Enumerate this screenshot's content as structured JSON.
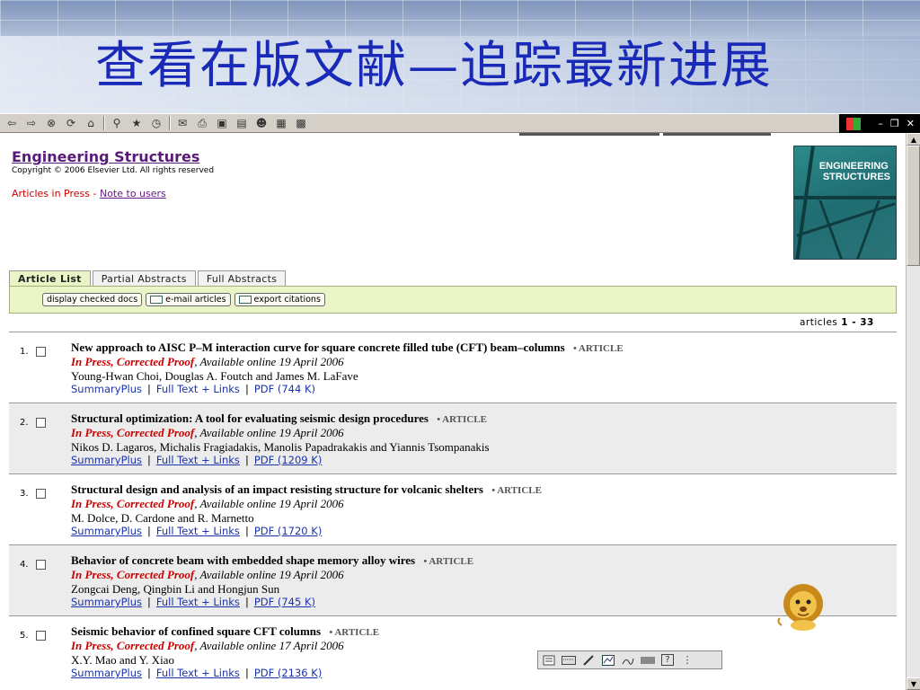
{
  "banner": {
    "title": "查看在版文献—追踪最新进展"
  },
  "toolbar": {
    "icons": [
      "back-icon",
      "forward-icon",
      "stop-icon",
      "refresh-icon",
      "home-icon",
      "search-icon",
      "favorites-icon",
      "history-icon",
      "mail-icon",
      "print-icon",
      "edit-icon",
      "discuss-icon",
      "messenger-icon",
      "research-icon",
      "media-icon"
    ],
    "glyphs": {
      "back": "⇦",
      "forward": "⇨",
      "stop": "⊗",
      "refresh": "⟳",
      "home": "⌂",
      "search": "⚲",
      "favorites": "★",
      "history": "◷",
      "mail": "✉",
      "print": "⎙",
      "edit": "▣",
      "discuss": "▤",
      "messenger": "☻",
      "research": "▦",
      "media": "▩"
    },
    "window_controls": {
      "minimize": "–",
      "restore": "❐",
      "close": "✕"
    }
  },
  "page": {
    "journal_title": "Engineering Structures",
    "copyright": "Copyright © 2006 Elsevier Ltd. All rights reserved",
    "articles_in_press": "Articles in Press",
    "separator": " - ",
    "note_to_users": "Note to users",
    "cover_text_line1": "ENGINEERING",
    "cover_text_line2": "STRUCTURES"
  },
  "tabs": [
    {
      "label": "Article List",
      "active": true
    },
    {
      "label": "Partial Abstracts",
      "active": false
    },
    {
      "label": "Full Abstracts",
      "active": false
    }
  ],
  "actions": {
    "display_checked": "display checked docs",
    "email_articles": "e-mail articles",
    "export_citations": "export citations"
  },
  "article_count": {
    "prefix": "articles ",
    "range": "1 - 33"
  },
  "articles": [
    {
      "num": "1.",
      "title": "New approach to AISC P–M interaction curve for square concrete filled tube (CFT) beam–columns",
      "type": "• ARTICLE",
      "in_press": "In Press, Corrected Proof",
      "available": ", Available online 19 April 2006",
      "authors": "Young-Hwan Choi, Douglas A. Foutch and James M. LaFave",
      "summary": "SummaryPlus",
      "fulltext": "Full Text + Links",
      "pdf": "PDF (744 K)"
    },
    {
      "num": "2.",
      "title": "Structural optimization: A tool for evaluating seismic design procedures",
      "type": "• ARTICLE",
      "in_press": "In Press, Corrected Proof",
      "available": ", Available online 19 April 2006",
      "authors": "Nikos D. Lagaros, Michalis Fragiadakis, Manolis Papadrakakis and Yiannis Tsompanakis",
      "summary": "SummaryPlus",
      "fulltext": "Full Text + Links",
      "pdf": "PDF (1209 K)"
    },
    {
      "num": "3.",
      "title": "Structural design and analysis of an impact resisting structure for volcanic shelters",
      "type": "• ARTICLE",
      "in_press": "In Press, Corrected Proof",
      "available": ", Available online 19 April 2006",
      "authors": "M. Dolce, D. Cardone and R. Marnetto",
      "summary": "SummaryPlus",
      "fulltext": "Full Text + Links",
      "pdf": "PDF (1720 K)"
    },
    {
      "num": "4.",
      "title": "Behavior of concrete beam with embedded shape memory alloy wires",
      "type": "• ARTICLE",
      "in_press": "In Press, Corrected Proof",
      "available": ", Available online 19 April 2006",
      "authors": "Zongcai Deng, Qingbin Li and Hongjun Sun",
      "summary": "SummaryPlus",
      "fulltext": "Full Text + Links",
      "pdf": "PDF (745 K)"
    },
    {
      "num": "5.",
      "title": "Seismic behavior of confined square CFT columns",
      "type": "• ARTICLE",
      "in_press": "In Press, Corrected Proof",
      "available": ", Available online 17 April 2006",
      "authors": "X.Y. Mao and Y. Xiao",
      "summary": "SummaryPlus",
      "fulltext": "Full Text + Links",
      "pdf": "PDF (2136 K)"
    }
  ],
  "link_separator": "|",
  "floating_toolbar": {
    "icons": [
      "insert-comment-icon",
      "keyboard-icon",
      "pen-icon",
      "write-pad-icon",
      "handwriting-icon",
      "help-icon",
      "menu-icon"
    ],
    "glyphs": {
      "help": "?",
      "menu": "⋮"
    }
  },
  "colors": {
    "banner_title": "#1a2ab8",
    "in_press": "#cc0000",
    "link": "#1a33aa",
    "journal": "#5a1a7a",
    "tab_active": "#eaf5c7"
  }
}
